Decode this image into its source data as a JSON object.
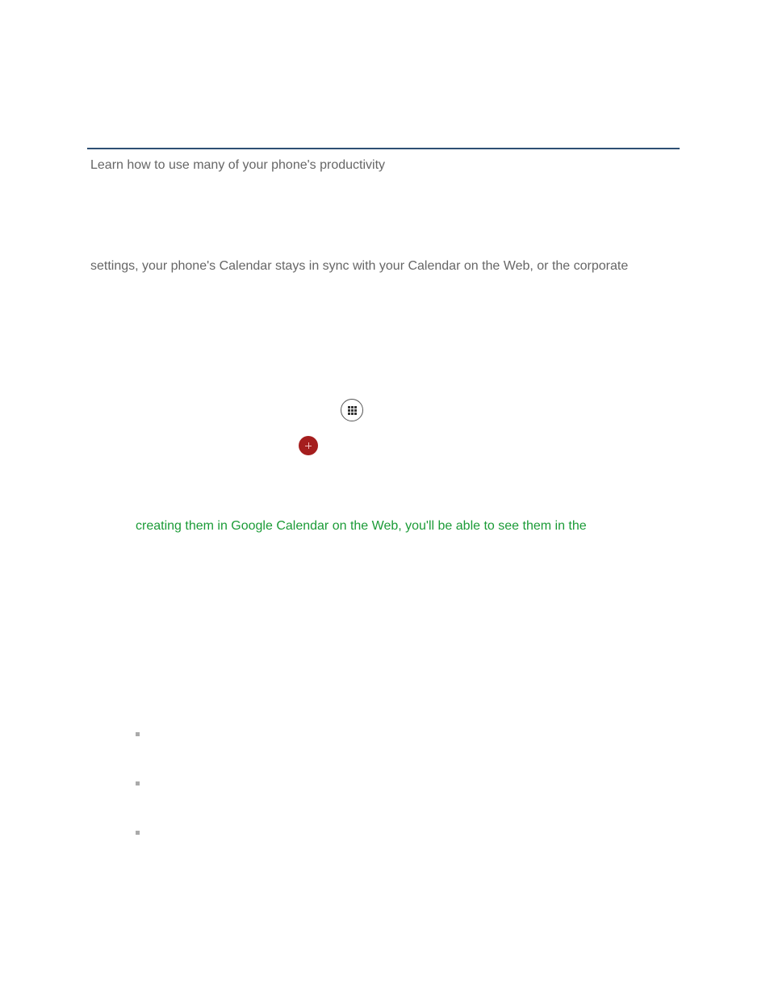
{
  "intro_text": "Learn how to use many of your phone's productivity",
  "mid_text": "settings, your phone's Calendar stays in sync with your Calendar on the Web, or the corporate",
  "green_text": "creating them in Google Calendar on the Web, you'll be able to see them in the",
  "icons": {
    "apps": "apps-grid-icon",
    "fab": "add-icon"
  }
}
